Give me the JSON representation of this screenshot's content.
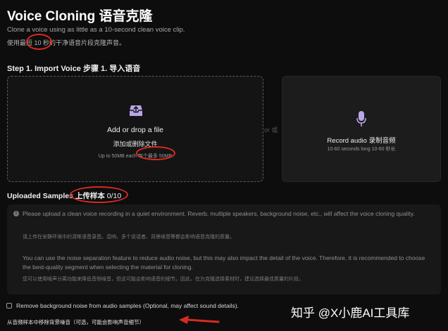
{
  "header": {
    "title": "Voice Cloning  语音克隆",
    "subtitle_en": "Clone a voice using as little as a 10-second clean voice clip.",
    "subtitle_cn": "使用最短 10 秒的干净语音片段克隆声音。"
  },
  "step": {
    "label": "Step 1. Import Voice  步骤 1. 导入语音"
  },
  "upload": {
    "icon": "upload-tray-icon",
    "title": "Add or drop a file",
    "title_cn": "添加或删除文件",
    "limit": "Up to 50MB each 每个最多 50MB"
  },
  "divider": {
    "or_text": "or 或"
  },
  "record": {
    "icon": "microphone-icon",
    "title": "Record audio  录制音频",
    "subtitle": "10-60 seconds long  10-60 秒长"
  },
  "samples": {
    "label": "Uploaded Samples ",
    "label_cn": "上传样本",
    "count": " 0/10"
  },
  "info": {
    "p1_en": "Please upload a clean voice recording in a quiet environment. Reverb, multiple speakers, background noise, etc., will affect the voice cloning quality.",
    "p1_cn": "请上传在安静环境中的清晰语音录音。混响、多个说话者、背景噪音等都会影响语音克隆的质量。",
    "p2_en": "You can use the noise separation feature to reduce audio noise, but this may also impact the detail of the voice. Therefore, it is recommended to choose the best-quality segment when selecting the material for cloning.",
    "p2_cn": "您可以使用噪声分离功能来降低音频噪音，但这可能会影响语音的细节。因此，在为克隆选择素材时，建议选择最佳质量的片段。"
  },
  "options": {
    "remove_noise_label": "Remove background noise from audio samples (Optional, may affect sound details).",
    "remove_noise_cn": "从音频样本中移除背景噪音（可选，可能会影响声音细节）",
    "remove_noise_checked": false
  },
  "watermark": {
    "text": "知乎 @X小鹿AI工具库"
  },
  "colors": {
    "background": "#0d0d0d",
    "panel": "#181818",
    "annotation_red": "#d72b22",
    "icon_purple": "#b8a6e8"
  }
}
